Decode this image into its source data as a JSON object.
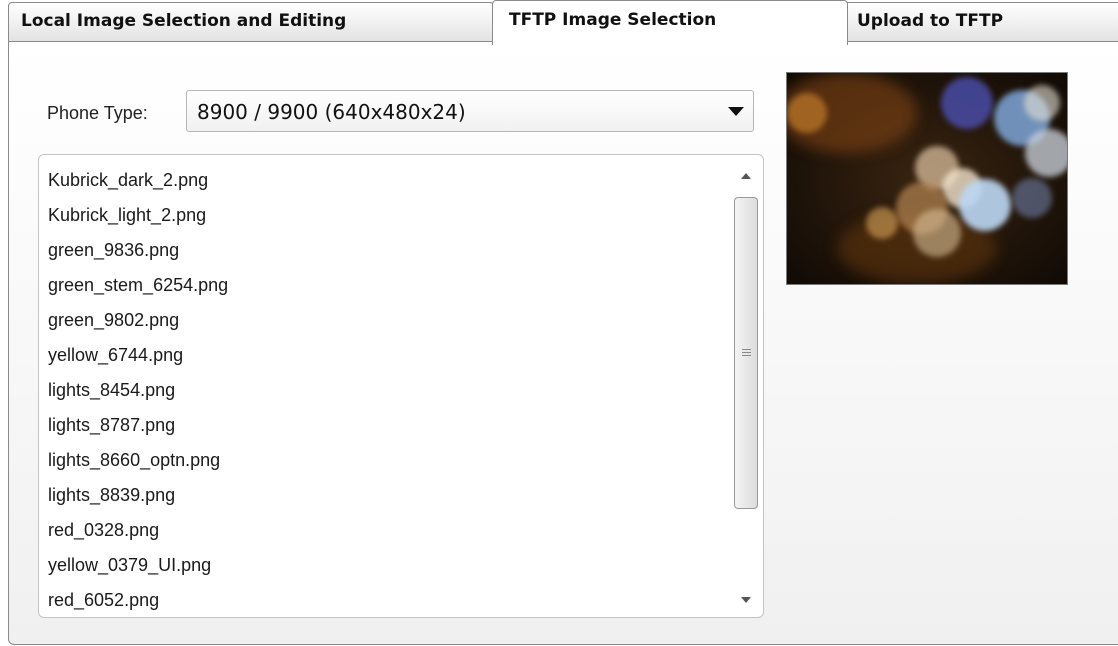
{
  "tabs": [
    {
      "label": "Local Image Selection and Editing",
      "active": false
    },
    {
      "label": "TFTP Image Selection",
      "active": true
    },
    {
      "label": "Upload to TFTP",
      "active": false
    }
  ],
  "phone_type": {
    "label": "Phone Type:",
    "selected": "8900 / 9900 (640x480x24)"
  },
  "files": [
    "Kubrick_dark_2.png",
    "Kubrick_light_2.png",
    "green_9836.png",
    "green_stem_6254.png",
    "green_9802.png",
    "yellow_6744.png",
    "lights_8454.png",
    "lights_8787.png",
    "lights_8660_optn.png",
    "lights_8839.png",
    "red_0328.png",
    "yellow_0379_UI.png",
    "red_6052.png"
  ],
  "icons": {
    "combo_arrow": "chevron-down-icon",
    "scroll_up": "scroll-up-arrow-icon",
    "scroll_down": "scroll-down-arrow-icon",
    "scroll_grip": "scroll-grip-icon"
  },
  "colors": {
    "tab_border": "#8a8a8a",
    "list_border": "#c4c4c4"
  }
}
